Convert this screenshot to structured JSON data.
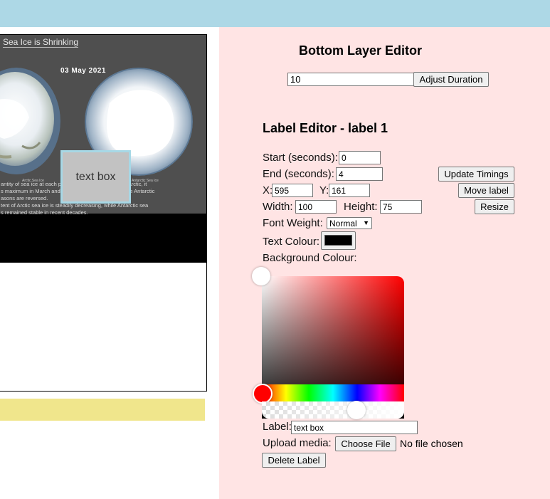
{
  "preview": {
    "video_title": "Sea Ice is Shrinking",
    "video_date": "03 May 2021",
    "globe_left_label": "Arctic Sea Ice",
    "globe_right_label": "Antarctic Sea Ice",
    "caption_lines": [
      "antity of sea ice at each pole varies seasonally. In the Arctic, it",
      "s maximum in March and minimum in September; in the Antarctic",
      "asons are reversed.",
      "tent of Arctic sea ice is steadily decreasing, while Antarctic sea",
      "s remained stable in recent decades."
    ],
    "overlay_label_text": "text box"
  },
  "bottom_editor": {
    "title": "Bottom Layer Editor",
    "duration_value": "10",
    "adjust_button": "Adjust Duration"
  },
  "label_editor": {
    "title": "Label Editor - label 1",
    "start_label": "Start (seconds):",
    "start_value": "0",
    "end_label": "End (seconds):",
    "end_value": "4",
    "update_timings_button": "Update Timings",
    "x_label": "X:",
    "x_value": "595",
    "y_label": "Y:",
    "y_value": "161",
    "move_label_button": "Move label",
    "width_label": "Width:",
    "width_value": "100",
    "height_label": "Height:",
    "height_value": "75",
    "resize_button": "Resize",
    "font_weight_label": "Font Weight:",
    "font_weight_value": "Normal",
    "text_colour_label": "Text Colour:",
    "text_colour_value": "#000000",
    "background_colour_label": "Background Colour:",
    "background_hue": "#ff0000",
    "label_label": "Label:",
    "label_value": "text box",
    "upload_label": "Upload media:",
    "choose_file_button": "Choose File",
    "no_file_text": "No file chosen",
    "delete_button": "Delete Label"
  },
  "colors": {
    "topbar": "#add8e6",
    "editor_bg": "#ffe4e4",
    "yellow_bar": "#f0e68c"
  }
}
